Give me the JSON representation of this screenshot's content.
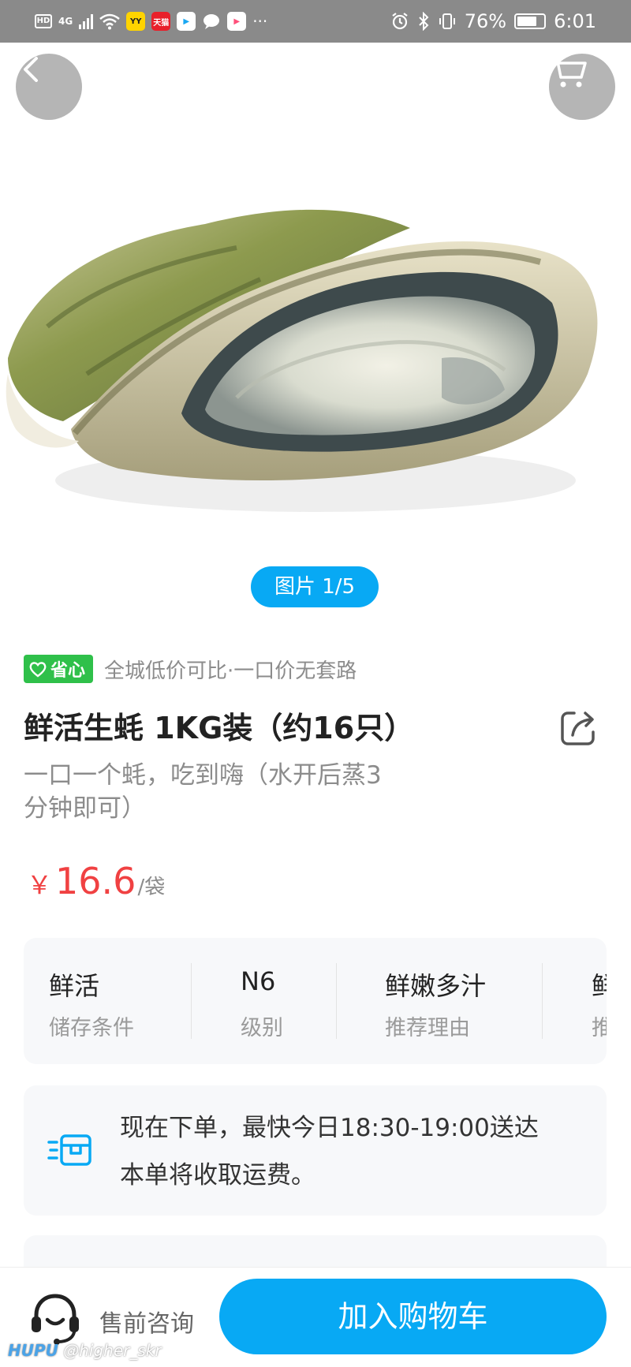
{
  "status_bar": {
    "hd": "HD",
    "network": "4G",
    "app_badges": [
      {
        "name": "yy",
        "text": "YY",
        "bg": "#ffd400",
        "fg": "#222222"
      },
      {
        "name": "tmall",
        "text": "天猫",
        "bg": "#e8202a",
        "fg": "#ffffff"
      },
      {
        "name": "youku",
        "text": "▶",
        "bg": "#ffffff",
        "fg": "#1aa7f2"
      },
      {
        "name": "video",
        "text": "▶",
        "bg": "#ffffff",
        "fg": "#ff4f7a"
      }
    ],
    "more": "···",
    "battery": "76%",
    "battery_level": 0.76,
    "time": "6:01"
  },
  "gallery": {
    "counter": "图片 1/5"
  },
  "product": {
    "badge": "省心",
    "tagline": "全城低价可比·一口价无套路",
    "title": "鲜活生蚝 1KG装（约16只）",
    "subtitle_lines": [
      "一口一个蚝，吃到嗨（水开后蒸3",
      "分钟即可）"
    ],
    "price_symbol": "￥",
    "price": "16.6",
    "price_unit": "/袋"
  },
  "specs": [
    {
      "value": "鲜活",
      "label": "储存条件"
    },
    {
      "value": "N6",
      "label": "级别"
    },
    {
      "value": "鲜嫩多汁",
      "label": "推荐理由"
    },
    {
      "value": "鲜",
      "label": "推"
    }
  ],
  "delivery": {
    "line1": "现在下单，最快今日18:30-19:00送达",
    "line2": "本单将收取运费。"
  },
  "bottom_bar": {
    "consult_label": "售前咨询",
    "add_to_cart_label": "加入购物车"
  },
  "watermark": {
    "brand": "HUPU",
    "user": "@higher_skr"
  },
  "colors": {
    "accent_blue": "#08a9f4",
    "price_red": "#f04142",
    "badge_green": "#2fc04a"
  }
}
